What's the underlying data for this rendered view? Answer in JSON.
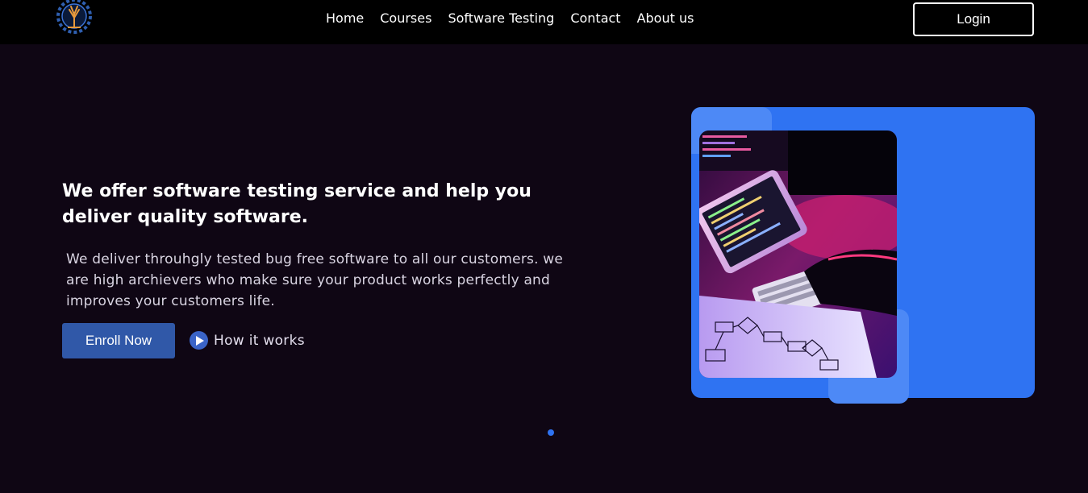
{
  "nav": {
    "logo_icon": "gear-tree-logo-icon",
    "links": [
      "Home",
      "Courses",
      "Software Testing",
      "Contact",
      "About us"
    ],
    "login_label": "Login"
  },
  "hero": {
    "title": "We offer software testing service and help you deliver quality software.",
    "description": "We deliver throuhgly tested bug free software to all our customers. we are high archievers who make sure your product works perfectly and improves your customers life.",
    "enroll_label": "Enroll Now",
    "how_label": "How it works",
    "how_icon": "play-icon"
  },
  "colors": {
    "background": "#0f0614",
    "navbar": "#000000",
    "accent_blue": "#2f73f2",
    "button_blue": "#3058a8"
  },
  "carousel": {
    "active_index": 0
  }
}
